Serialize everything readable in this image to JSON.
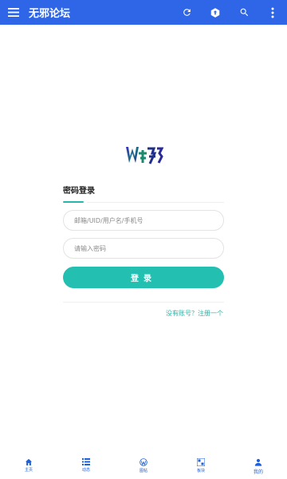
{
  "appbar": {
    "title": "无邪论坛",
    "icons": [
      "menu-icon",
      "refresh-icon",
      "upload-icon",
      "search-icon",
      "more-vert-icon"
    ],
    "color": "#2f66e8"
  },
  "login": {
    "tab_label": "密码登录",
    "account_placeholder": "邮箱/UID/用户名/手机号",
    "password_placeholder": "请输入密码",
    "button_label": "登录",
    "register_link": "没有账号？注册一个",
    "accent_color": "#23bfb1"
  },
  "bottom_nav": {
    "items": [
      {
        "label": "主页",
        "icon": "home-icon"
      },
      {
        "label": "动态",
        "icon": "list-icon"
      },
      {
        "label": "图帖",
        "icon": "wordpress-icon"
      },
      {
        "label": "板块",
        "icon": "dashboard-icon"
      },
      {
        "label": "我的",
        "icon": "person-icon",
        "active": true
      }
    ],
    "color": "#1f5fd8"
  }
}
